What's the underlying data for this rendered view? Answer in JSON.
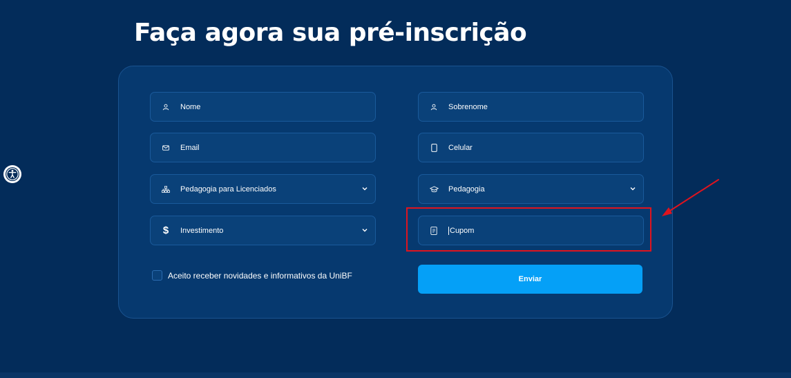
{
  "header": {
    "title": "Faça agora sua pré-inscrição"
  },
  "form": {
    "first_name": {
      "placeholder": "Nome",
      "icon": "user-icon"
    },
    "last_name": {
      "placeholder": "Sobrenome",
      "icon": "user-icon"
    },
    "email": {
      "placeholder": "Email",
      "icon": "mail-icon"
    },
    "phone": {
      "placeholder": "Celular",
      "icon": "phone-icon"
    },
    "course_type": {
      "selected": "Pedagogia para Licenciados",
      "icon": "sitemap-icon"
    },
    "course": {
      "selected": "Pedagogia",
      "icon": "graduation-cap-icon"
    },
    "investment": {
      "selected": "Investimento",
      "icon": "dollar-icon"
    },
    "coupon": {
      "placeholder": "Cupom",
      "icon": "coupon-icon"
    },
    "consent_label": "Aceito receber novidades e informativos da UniBF",
    "submit_label": "Enviar"
  },
  "annotation": {
    "highlight_color": "#e0141e",
    "target": "coupon-field"
  },
  "colors": {
    "background": "#032c5a",
    "card": "#06396f",
    "field": "#0a4179",
    "accent": "#05a0f7"
  }
}
